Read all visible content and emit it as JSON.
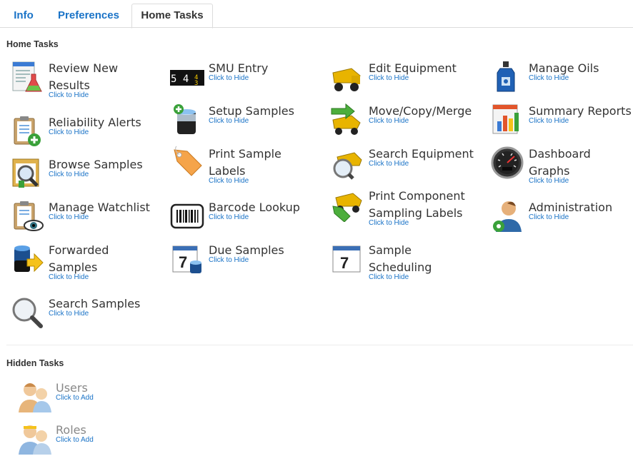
{
  "tabs": [
    {
      "label": "Info",
      "active": false
    },
    {
      "label": "Preferences",
      "active": false
    },
    {
      "label": "Home Tasks",
      "active": true
    }
  ],
  "home_tasks": {
    "title": "Home Tasks",
    "tasks": [
      {
        "label": "Review New Results",
        "action": "Click to Hide",
        "icon": "report-flask-icon"
      },
      {
        "label": "Reliability Alerts",
        "action": "Click to Hide",
        "icon": "clipboard-add-icon"
      },
      {
        "label": "Browse Samples",
        "action": "Click to Hide",
        "icon": "browse-magnifier-icon"
      },
      {
        "label": "Manage Watchlist",
        "action": "Click to Hide",
        "icon": "clipboard-eye-icon"
      },
      {
        "label": "Forwarded Samples",
        "action": "Click to Hide",
        "icon": "bottle-forward-arrow-icon"
      },
      {
        "label": "Search Samples",
        "action": "Click to Hide",
        "icon": "magnifier-icon"
      },
      {
        "label": "SMU Entry",
        "action": "Click to Hide",
        "icon": "odometer-counter-icon"
      },
      {
        "label": "Setup Samples",
        "action": "Click to Hide",
        "icon": "bottle-add-icon"
      },
      {
        "label": "Print Sample Labels",
        "action": "Click to Hide",
        "icon": "tag-label-icon"
      },
      {
        "label": "Barcode Lookup",
        "action": "Click to Hide",
        "icon": "barcode-icon"
      },
      {
        "label": "Due Samples",
        "action": "Click to Hide",
        "icon": "calendar-bottle-icon"
      },
      {
        "label": "Edit Equipment",
        "action": "Click to Hide",
        "icon": "dump-truck-icon"
      },
      {
        "label": "Move/Copy/Merge",
        "action": "Click to Hide",
        "icon": "truck-arrow-icon"
      },
      {
        "label": "Search Equipment",
        "action": "Click to Hide",
        "icon": "truck-magnifier-icon"
      },
      {
        "label": "Print Component Sampling Labels",
        "action": "Click to Hide",
        "icon": "truck-tag-icon"
      },
      {
        "label": "Sample Scheduling",
        "action": "Click to Hide",
        "icon": "calendar-icon"
      },
      {
        "label": "Manage Oils",
        "action": "Click to Hide",
        "icon": "oil-bottle-icon"
      },
      {
        "label": "Summary Reports",
        "action": "Click to Hide",
        "icon": "bar-chart-report-icon"
      },
      {
        "label": "Dashboard Graphs",
        "action": "Click to Hide",
        "icon": "speedometer-icon"
      },
      {
        "label": "Administration",
        "action": "Click to Hide",
        "icon": "admin-user-key-icon"
      }
    ]
  },
  "hidden_tasks": {
    "title": "Hidden Tasks",
    "tasks": [
      {
        "label": "Users",
        "action": "Click to Add",
        "icon": "users-icon"
      },
      {
        "label": "Roles",
        "action": "Click to Add",
        "icon": "roles-icon"
      }
    ]
  },
  "colors": {
    "link": "#1a73c7",
    "text": "#333333",
    "muted": "#888888",
    "border": "#dcdcdc"
  }
}
